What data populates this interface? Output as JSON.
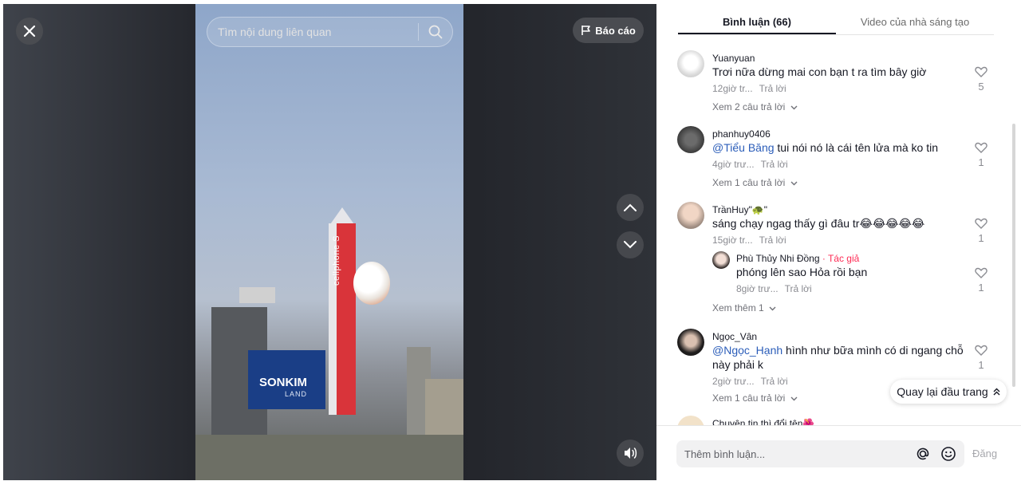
{
  "video": {
    "search_placeholder": "Tìm nội dung liên quan",
    "report_label": "Báo cáo",
    "rocket_brand": "cellphone S",
    "sign_brand": "SONKIM",
    "sign_sub": "LAND"
  },
  "tabs": [
    {
      "label": "Bình luận (66)",
      "active": true
    },
    {
      "label": "Video của nhà sáng tạo",
      "active": false
    }
  ],
  "comments": [
    {
      "user": "Yuanyuan",
      "text": "Trơi nữa dừng mai con bạn t ra tìm bây giờ",
      "time": "12giờ tr...",
      "reply": "Trả lời",
      "likes": "5",
      "view_more": "Xem 2 câu trả lời"
    },
    {
      "user": "phanhuy0406",
      "mention": "@Tiểu Băng",
      "text": " tui nói nó là cái tên lửa mà ko tin",
      "time": "4giờ trư...",
      "reply": "Trả lời",
      "likes": "1",
      "view_more": "Xem 1 câu trả lời"
    },
    {
      "user": "TrầnHuy\"🐢\"",
      "text": "sáng chạy ngag thấy gì đâu tr😂😂😂😂😂",
      "time": "15giờ tr...",
      "reply": "Trả lời",
      "likes": "1"
    },
    {
      "user": "Ngọc_Vân",
      "mention": "@Ngọc_Hạnh",
      "text": " hình như bữa mình có di ngang chỗ này phải k",
      "time": "2giờ trư...",
      "reply": "Trả lời",
      "likes": "1",
      "view_more": "Xem 1 câu trả lời"
    },
    {
      "user": "Chuyên tin thì đổi tên🌺"
    }
  ],
  "nested_reply": {
    "user": "Phù Thủy Nhi Đồng",
    "author_tag": " · Tác giả",
    "text": "phóng lên sao Hỏa rồi bạn",
    "time": "8giờ trư...",
    "reply": "Trả lời",
    "likes": "1",
    "view_more": "Xem thêm 1"
  },
  "back_to_top": "Quay lại đầu trang",
  "footer": {
    "input_placeholder": "Thêm bình luận...",
    "post_label": "Đăng"
  }
}
